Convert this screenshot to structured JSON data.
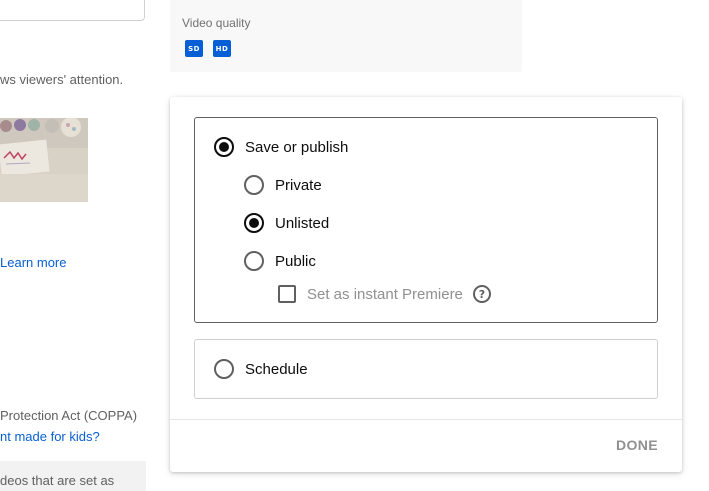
{
  "left": {
    "attention_text": "ws viewers' attention.",
    "learn_more": "Learn more",
    "coppa_text": "Protection Act (COPPA)",
    "made_for_kids_link": "nt made for kids?",
    "bottom_text": "deos that are set as"
  },
  "quality": {
    "label": "Video quality",
    "badges": [
      "SD",
      "HD"
    ]
  },
  "visibility": {
    "save_or_publish": "Save or publish",
    "private": "Private",
    "unlisted": "Unlisted",
    "public": "Public",
    "instant_premiere": "Set as instant Premiere",
    "help_glyph": "?",
    "schedule": "Schedule",
    "selected_mode": "save_or_publish",
    "selected_privacy": "unlisted",
    "instant_premiere_checked": false
  },
  "footer": {
    "done": "DONE"
  },
  "colors": {
    "accent": "#065fd4",
    "link": "#065fd4",
    "disabled_text": "#909090"
  }
}
